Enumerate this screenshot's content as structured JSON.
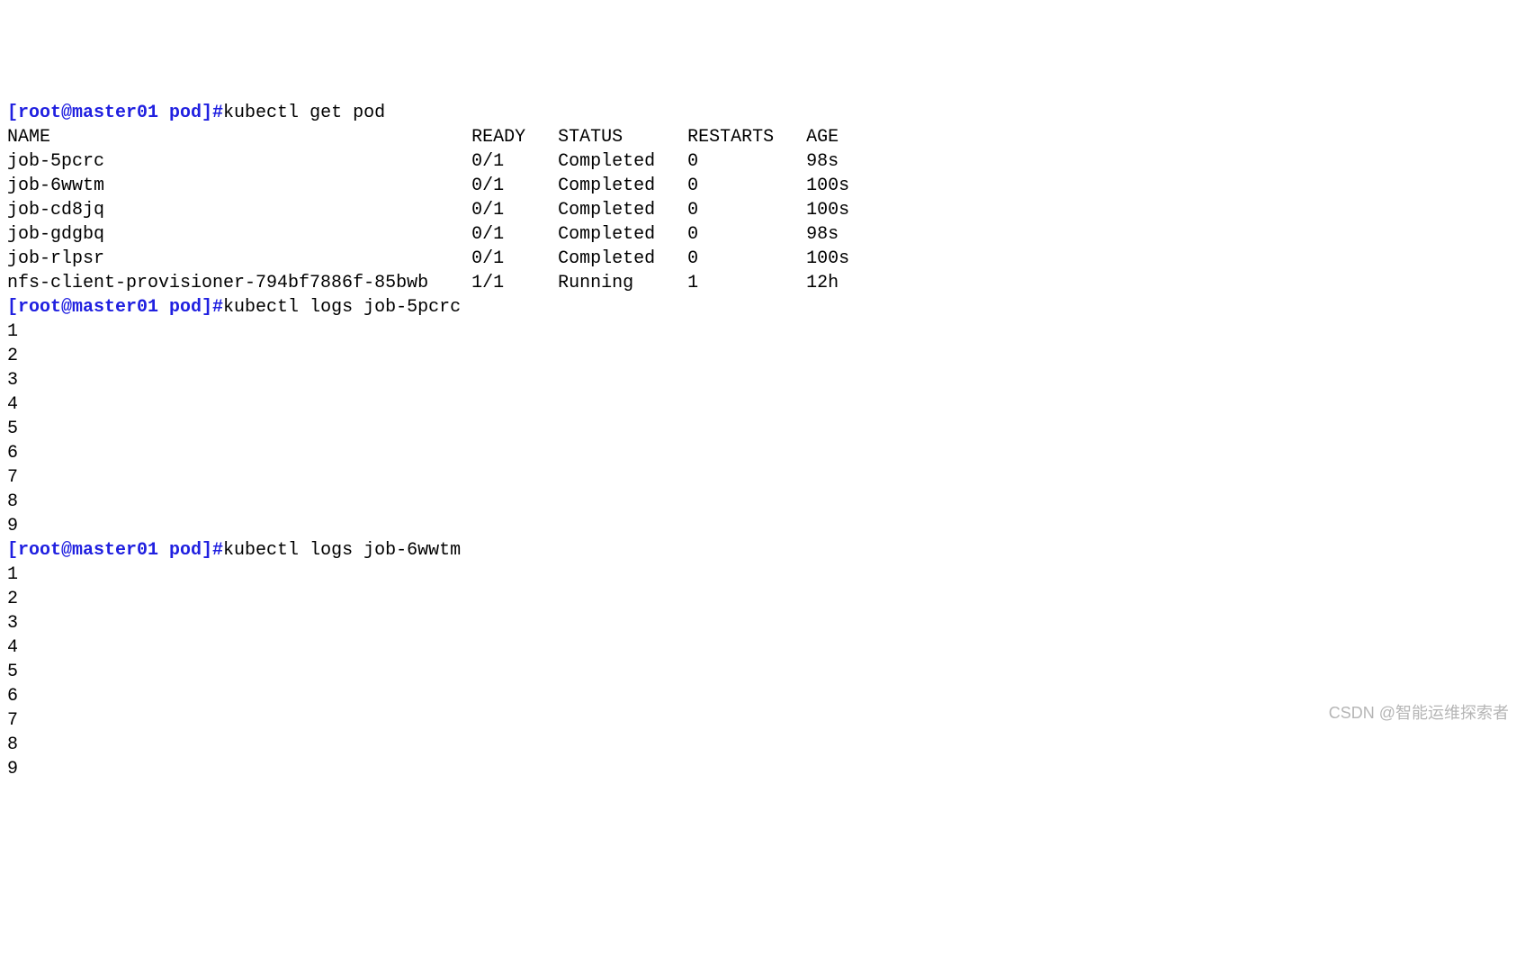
{
  "prompt_text": "[root@master01 pod]#",
  "commands": {
    "cmd1": "kubectl get pod",
    "cmd2": "kubectl logs job-5pcrc",
    "cmd3": "kubectl logs job-6wwtm"
  },
  "table": {
    "header": {
      "name": "NAME",
      "ready": "READY",
      "status": "STATUS",
      "restarts": "RESTARTS",
      "age": "AGE"
    },
    "rows": [
      {
        "name": "job-5pcrc",
        "ready": "0/1",
        "status": "Completed",
        "restarts": "0",
        "age": "98s"
      },
      {
        "name": "job-6wwtm",
        "ready": "0/1",
        "status": "Completed",
        "restarts": "0",
        "age": "100s"
      },
      {
        "name": "job-cd8jq",
        "ready": "0/1",
        "status": "Completed",
        "restarts": "0",
        "age": "100s"
      },
      {
        "name": "job-gdgbq",
        "ready": "0/1",
        "status": "Completed",
        "restarts": "0",
        "age": "98s"
      },
      {
        "name": "job-rlpsr",
        "ready": "0/1",
        "status": "Completed",
        "restarts": "0",
        "age": "100s"
      },
      {
        "name": "nfs-client-provisioner-794bf7886f-85bwb",
        "ready": "1/1",
        "status": "Running",
        "restarts": "1",
        "age": "12h"
      }
    ]
  },
  "logs1": [
    "1",
    "2",
    "3",
    "4",
    "5",
    "6",
    "7",
    "8",
    "9"
  ],
  "logs2": [
    "1",
    "2",
    "3",
    "4",
    "5",
    "6",
    "7",
    "8",
    "9"
  ],
  "watermark": "CSDN @智能运维探索者",
  "col_widths": {
    "name": 43,
    "ready": 8,
    "status": 12,
    "restarts": 11
  }
}
